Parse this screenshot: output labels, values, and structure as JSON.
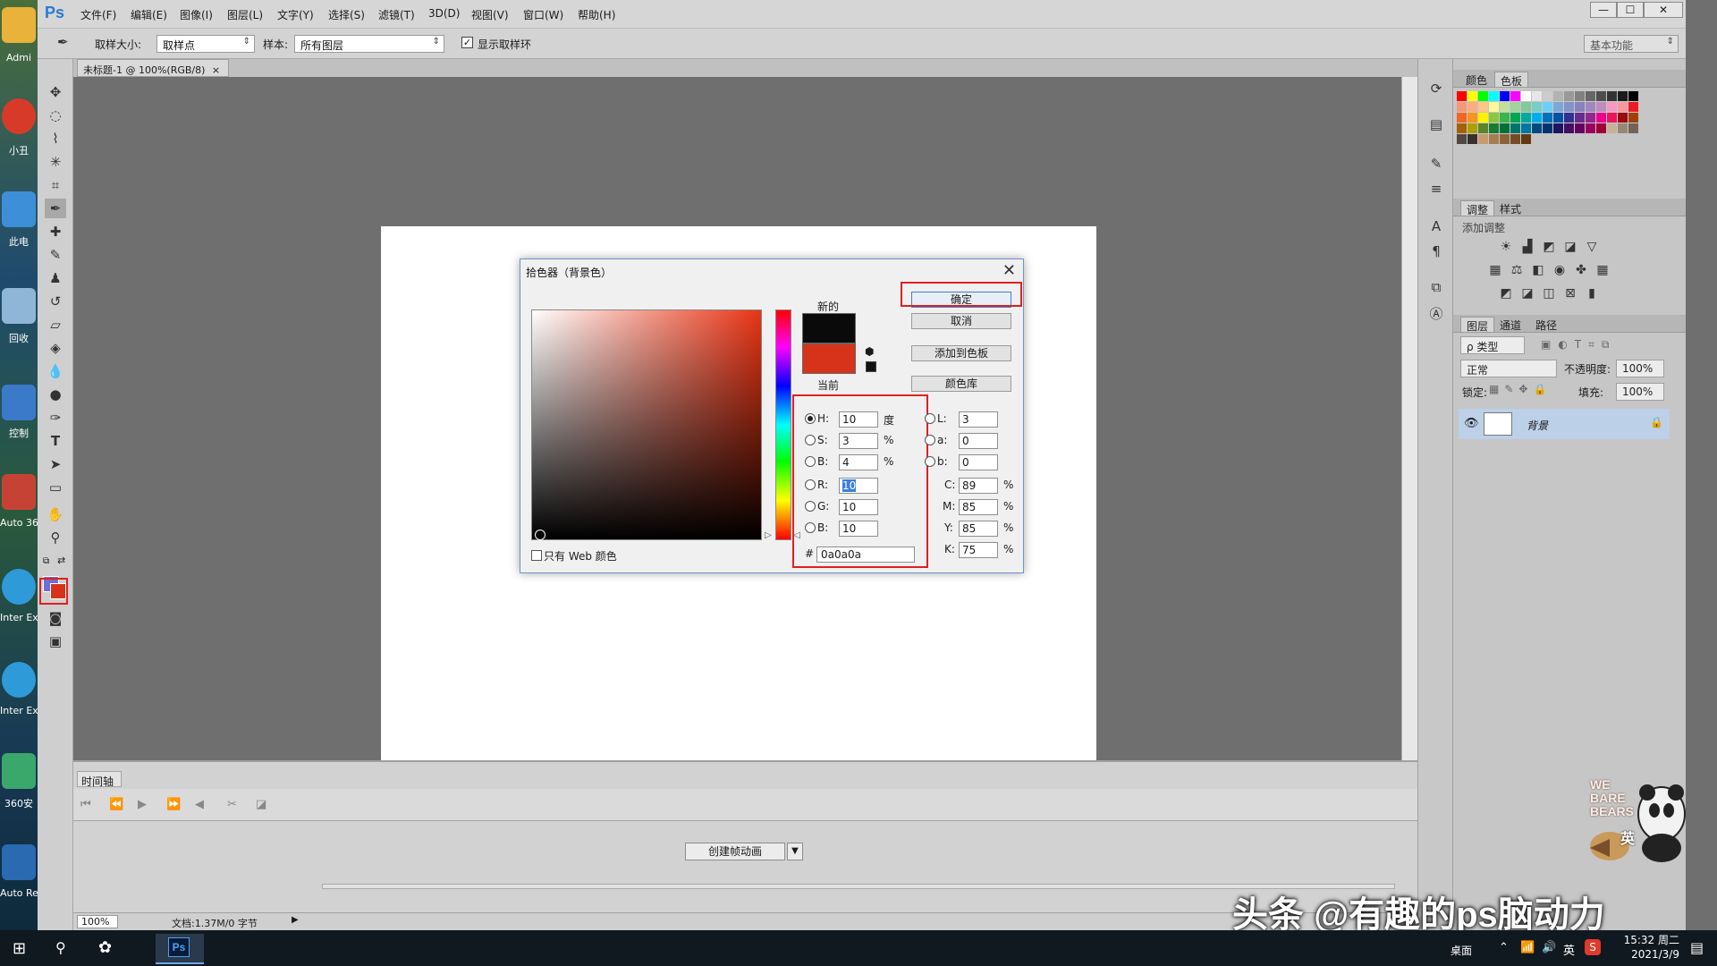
{
  "desktop": {
    "icons": [
      {
        "label": "Admi"
      },
      {
        "label": "小丑"
      },
      {
        "label": "此电"
      },
      {
        "label": "回收"
      },
      {
        "label": "控制"
      },
      {
        "label": "Auto 36"
      },
      {
        "label": "Inter Expl"
      },
      {
        "label": "Inter Expl"
      },
      {
        "label": "360安"
      },
      {
        "label": "Auto ReC"
      }
    ]
  },
  "app": {
    "logo": "Ps",
    "menus": [
      "文件(F)",
      "编辑(E)",
      "图像(I)",
      "图层(L)",
      "文字(Y)",
      "选择(S)",
      "滤镜(T)",
      "3D(D)",
      "视图(V)",
      "窗口(W)",
      "帮助(H)"
    ],
    "window_buttons": [
      "—",
      "☐",
      "✕"
    ]
  },
  "options": {
    "sample_size_label": "取样大小:",
    "sample_size_value": "取样点",
    "sample_label": "样本:",
    "sample_value": "所有图层",
    "show_ring_label": "显示取样环",
    "workspace": "基本功能"
  },
  "document_tab": {
    "title": "未标题-1 @ 100%(RGB/8)",
    "close": "×"
  },
  "timeline": {
    "tab": "时间轴",
    "create_button": "创建帧动画",
    "dropdown_arrow": "▼"
  },
  "status": {
    "zoom": "100%",
    "doc_info": "文档:1.37M/0 字节"
  },
  "panels": {
    "color_tabs": [
      "颜色",
      "色板"
    ],
    "adjust_tabs": [
      "调整",
      "样式"
    ],
    "adjust_heading": "添加调整",
    "layers_tabs": [
      "图层",
      "通道",
      "路径"
    ],
    "filter_type": "ρ 类型",
    "blend_mode": "正常",
    "opacity_label": "不透明度:",
    "opacity_value": "100%",
    "lock_label": "锁定:",
    "fill_label": "填充:",
    "fill_value": "100%",
    "layer_name": "背景"
  },
  "picker": {
    "title": "拾色器（背景色）",
    "close": "✕",
    "new_label": "新的",
    "current_label": "当前",
    "new_color": "#0a0a0a",
    "current_color": "#d7331a",
    "buttons": {
      "ok": "确定",
      "cancel": "取消",
      "add_swatch": "添加到色板",
      "library": "颜色库"
    },
    "hsb": {
      "h_label": "H:",
      "h": "10",
      "h_unit": "度",
      "s_label": "S:",
      "s": "3",
      "s_unit": "%",
      "b_label": "B:",
      "b": "4",
      "b_unit": "%"
    },
    "rgb": {
      "r_label": "R:",
      "r": "10",
      "g_label": "G:",
      "g": "10",
      "b_label": "B:",
      "b": "10"
    },
    "lab": {
      "l_label": "L:",
      "l": "3",
      "a_label": "a:",
      "a": "0",
      "b_label": "b:",
      "b": "0"
    },
    "cmyk": {
      "c_label": "C:",
      "c": "89",
      "m_label": "M:",
      "m": "85",
      "y_label": "Y:",
      "y": "85",
      "k_label": "K:",
      "k": "75",
      "unit": "%"
    },
    "hex_label": "#",
    "hex": "0a0a0a",
    "web_only": "只有 Web 颜色"
  },
  "taskbar": {
    "desktop_label": "桌面",
    "ime": "英",
    "time": "15:32 周二",
    "date": "2021/3/9"
  },
  "overlay": {
    "watermark": "头条 @有趣的ps脑动力",
    "bears_text": "WE BARE BEARS",
    "bears_ime": "英"
  },
  "colors": {
    "accent": "#2a7bd4",
    "highlight_red": "#e0201f",
    "layer_selected": "#bcd0e8"
  }
}
